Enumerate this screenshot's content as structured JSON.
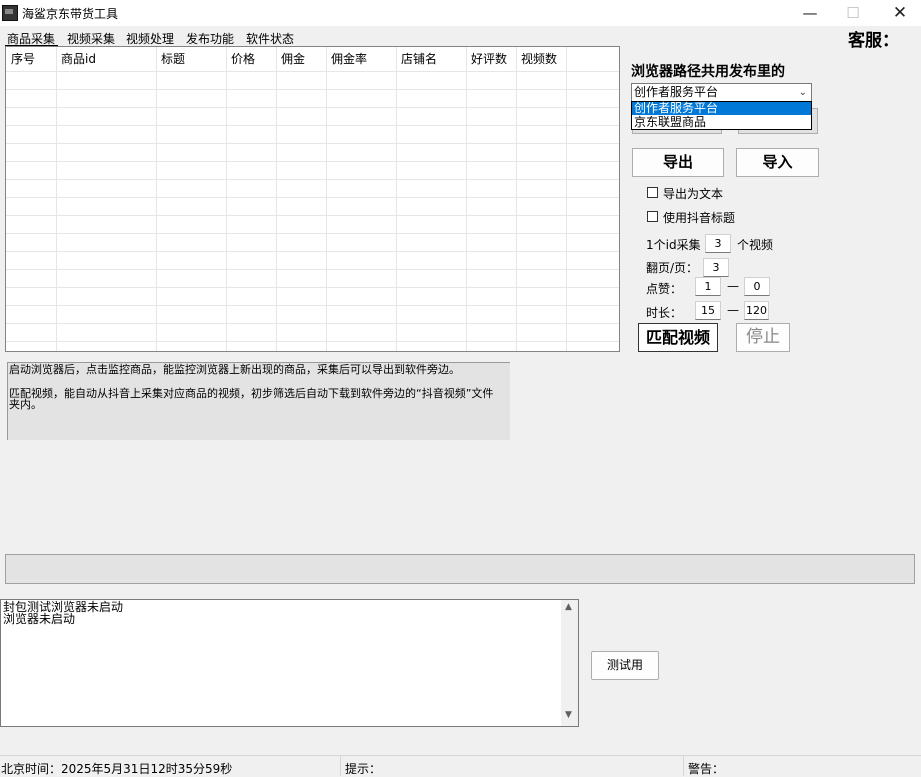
{
  "window": {
    "title": "海鲨京东带货工具",
    "minimize_glyph": "—",
    "maximize_glyph": "☐",
    "close_glyph": "✕"
  },
  "menu": [
    "商品采集",
    "视频采集",
    "视频处理",
    "发布功能",
    "软件状态"
  ],
  "service_label": "客服：",
  "table": {
    "columns": [
      "序号",
      "商品id",
      "标题",
      "价格",
      "佣金",
      "佣金率",
      "店铺名",
      "好评数",
      "视频数"
    ],
    "rows": []
  },
  "right_panel": {
    "path_label": "浏览器路径共用发布里的",
    "platform_select": {
      "value": "创作者服务平台",
      "options": [
        "创作者服务平台",
        "京东联盟商品"
      ],
      "highlighted_index": 0
    },
    "export_button": "导出",
    "import_button": "导入",
    "checkbox_export_text": {
      "label": "导出为文本",
      "checked": false
    },
    "checkbox_douyin_title": {
      "label": "使用抖音标题",
      "checked": false
    },
    "per_id_label": "1个id采集",
    "per_id_value": "3",
    "videos_label": "个视频",
    "pages_label": "翻页/页：",
    "pages_value": "3",
    "likes_label": "点赞：",
    "likes_min": "1",
    "likes_max": "0",
    "duration_label": "时长：",
    "duration_min": "15",
    "duration_max": "120",
    "range_dash": "—",
    "match_button": "匹配视频",
    "stop_button": "停止"
  },
  "info": {
    "line1": "启动浏览器后，点击监控商品，能监控浏览器上新出现的商品，采集后可以导出到软件旁边。",
    "line2": "匹配视频，能自动从抖音上采集对应商品的视频，初步筛选后自动下载到软件旁边的“抖音视频”文件夹内。"
  },
  "log": {
    "lines": [
      "封包测试浏览器未启动",
      "浏览器未启动"
    ],
    "scroll_up_glyph": "▲",
    "scroll_down_glyph": "▼"
  },
  "test_button": "测试用",
  "statusbar": {
    "time": "北京时间：2025年5月31日12时35分59秒",
    "tip": "提示：",
    "warning": "警告："
  },
  "colors": {
    "window_bg": "#f0f0f0",
    "selection_blue": "#0078d7",
    "info_bg": "#e3e3e3"
  }
}
